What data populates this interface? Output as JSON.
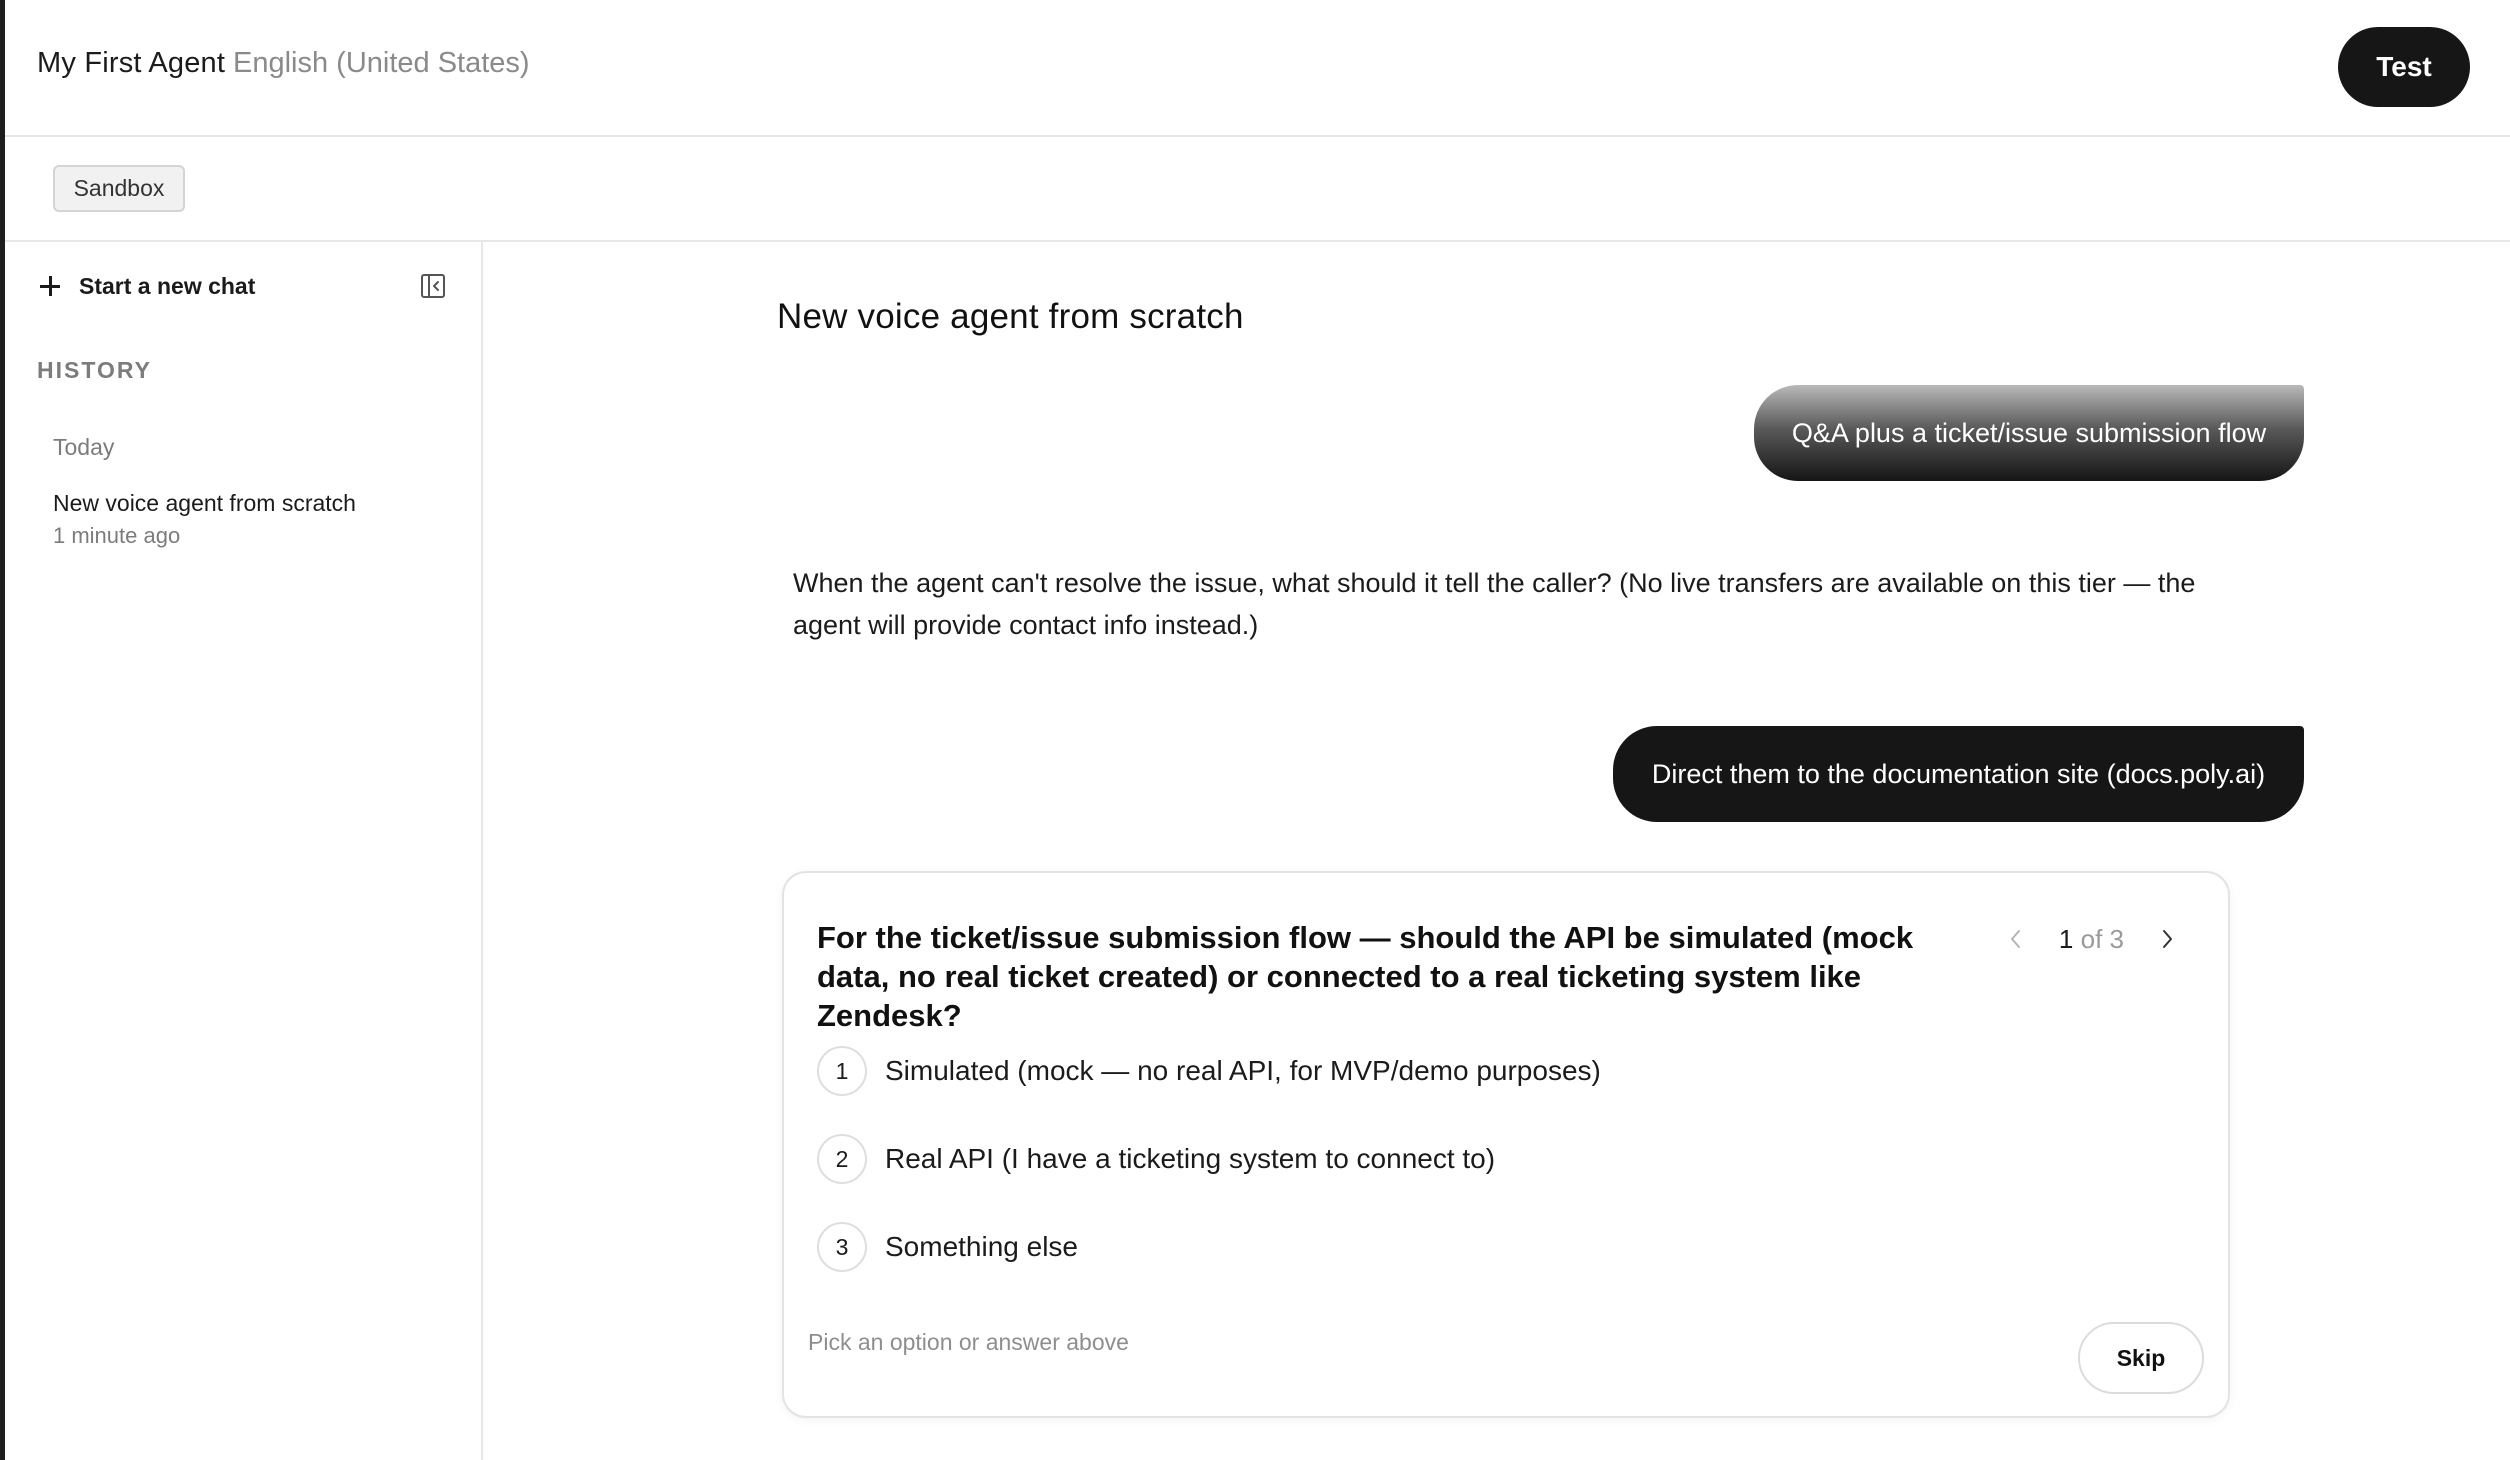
{
  "header": {
    "agent_name": "My First Agent",
    "language": "English (United States)",
    "test_label": "Test"
  },
  "environment": {
    "label": "Sandbox"
  },
  "sidebar": {
    "new_chat_label": "Start a new chat",
    "history_heading": "HISTORY",
    "groups": [
      {
        "label": "Today",
        "items": [
          {
            "title": "New voice agent from scratch",
            "time": "1 minute ago"
          }
        ]
      }
    ]
  },
  "chat": {
    "title": "New voice agent from scratch",
    "messages": [
      {
        "role": "user",
        "text": "Q&A plus a ticket/issue submission flow"
      },
      {
        "role": "assistant",
        "text": "When the agent can't resolve the issue, what should it tell the caller? (No live transfers are available on this tier — the agent will provide contact info instead.)"
      },
      {
        "role": "user",
        "text": "Direct them to the documentation site (docs.poly.ai)"
      }
    ],
    "question": {
      "text": "For the ticket/issue submission flow — should the API be simulated (mock data, no real ticket created) or connected to a real ticketing system like Zendesk?",
      "pager_current": "1",
      "pager_total_text": "of 3",
      "options": [
        {
          "number": "1",
          "label": "Simulated (mock — no real API, for MVP/demo purposes)"
        },
        {
          "number": "2",
          "label": "Real API (I have a ticketing system to connect to)"
        },
        {
          "number": "3",
          "label": "Something else"
        }
      ],
      "input_placeholder": "Pick an option or answer above",
      "input_value": "",
      "skip_label": "Skip"
    }
  },
  "icons": {
    "new_chat": "plus-icon",
    "collapse_sidebar": "sidebar-collapse-icon",
    "pager_prev": "chevron-left-icon",
    "pager_next": "chevron-right-icon"
  },
  "colors": {
    "primary_button": "#161616",
    "user_bubble": "#161616",
    "muted_text": "#8a8a8a",
    "border": "#e7e7e7"
  }
}
